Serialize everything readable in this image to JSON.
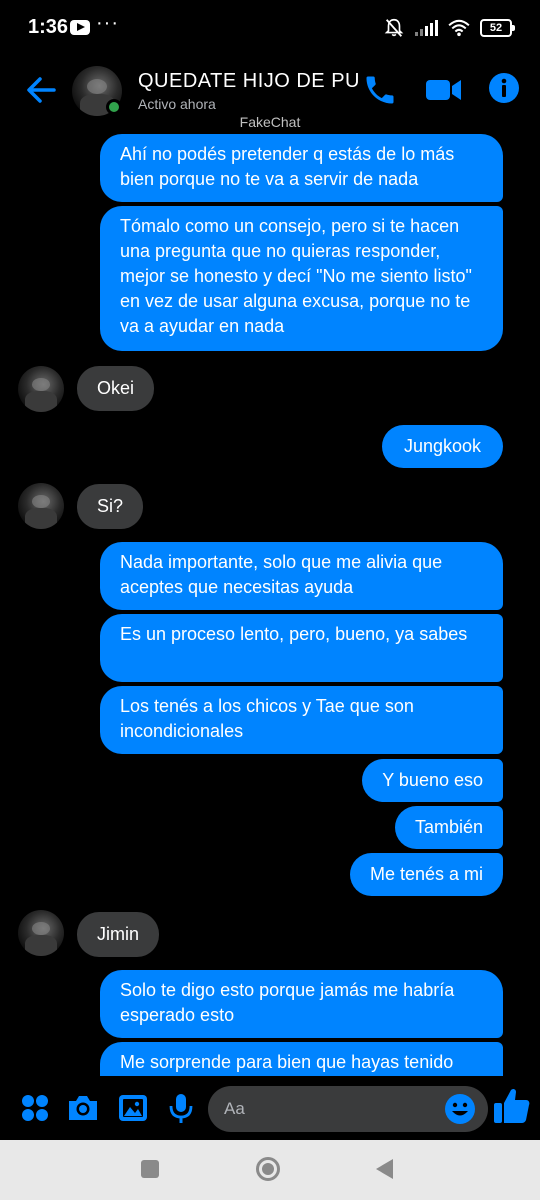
{
  "status_bar": {
    "time": "1:36",
    "dots": "···",
    "battery": "52"
  },
  "header": {
    "title": "QUEDATE HIJO DE PU…",
    "status": "Activo ahora",
    "watermark": "FakeChat"
  },
  "colors": {
    "accent": "#0084ff",
    "incoming_bubble": "#3a3b3c",
    "online": "#31a24c"
  },
  "messages": [
    {
      "side": "out",
      "text": "Ahí no podés pretender q estás de lo más bien porque no te va a servir de nada"
    },
    {
      "side": "out",
      "text": "Tómalo como un consejo, pero si te hacen una pregunta que no quieras responder, mejor se honesto y decí \"No me siento listo\" en vez de usar alguna excusa, porque no te va a ayudar en nada"
    },
    {
      "side": "in",
      "text": "Okei"
    },
    {
      "side": "out",
      "text": "Jungkook"
    },
    {
      "side": "in",
      "text": "Si?"
    },
    {
      "side": "out",
      "text": "Nada importante, solo que me alivia que aceptes que necesitas ayuda"
    },
    {
      "side": "out",
      "text": "Es un proceso lento, pero, bueno, ya sabes"
    },
    {
      "side": "out",
      "text": "Los tenés a los chicos y Tae que son incondicionales"
    },
    {
      "side": "out",
      "text": "Y bueno eso"
    },
    {
      "side": "out",
      "text": "También"
    },
    {
      "side": "out",
      "text": "Me tenés a mi"
    },
    {
      "side": "in",
      "text": "Jimin"
    },
    {
      "side": "out",
      "text": "Solo te digo esto porque jamás me habría esperado esto"
    },
    {
      "side": "out",
      "text": "Me sorprende para bien que hayas tenido"
    }
  ],
  "composer": {
    "placeholder": "Aa",
    "icons": [
      "apps-icon",
      "camera-icon",
      "image-icon",
      "microphone-icon",
      "emoji-icon",
      "thumbs-up-icon"
    ]
  },
  "nav_bar": {
    "icons": [
      "recents-icon",
      "home-icon",
      "back-icon"
    ]
  }
}
